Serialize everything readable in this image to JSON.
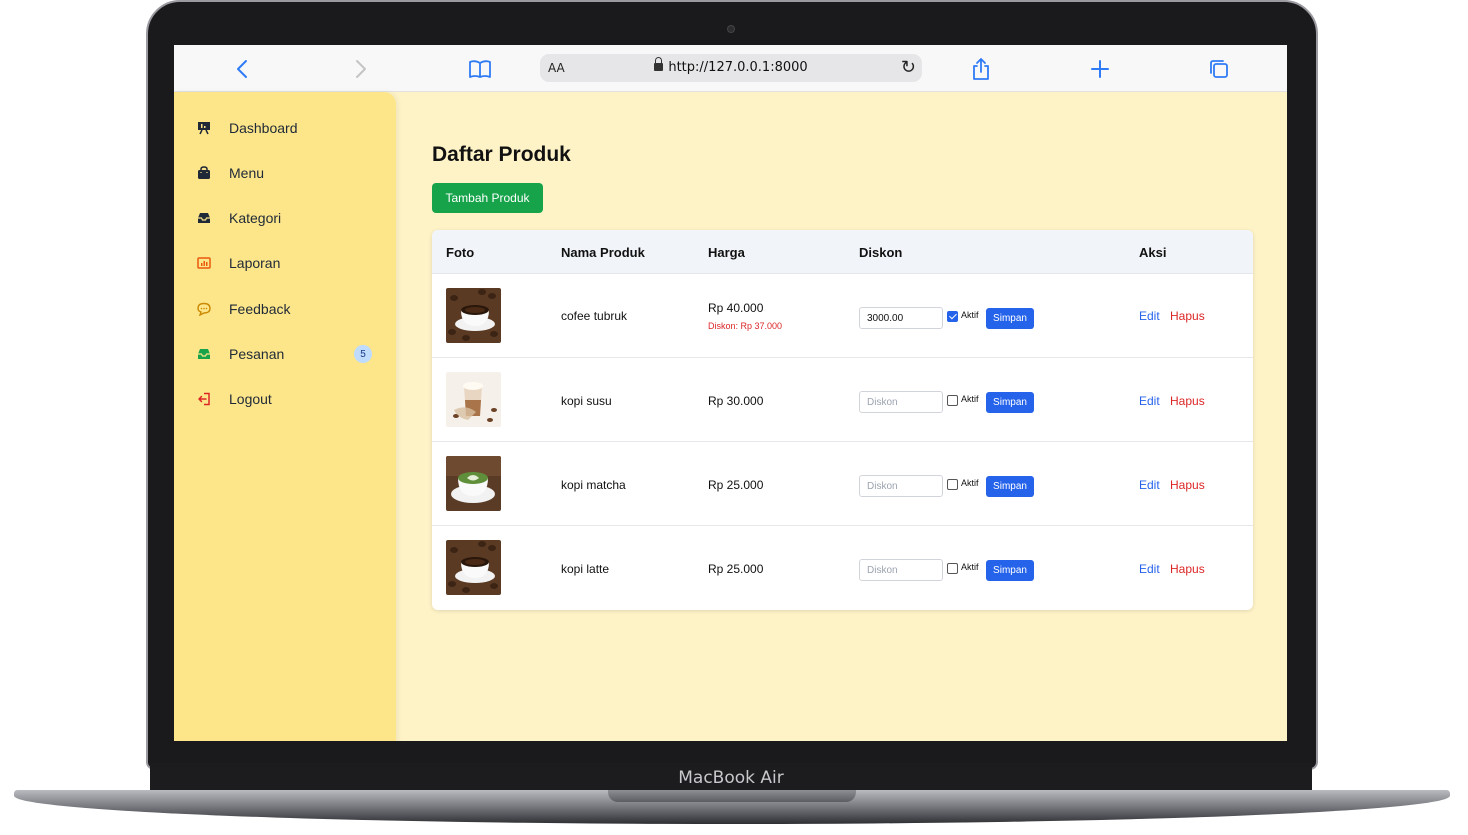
{
  "device": {
    "brand": "MacBook Air"
  },
  "browser": {
    "aa_label": "AA",
    "url": "http://127.0.0.1:8000",
    "icons": [
      "chevron-left-icon",
      "chevron-right-icon",
      "book-icon",
      "lock-icon",
      "reload-icon",
      "share-icon",
      "plus-icon",
      "tabs-icon"
    ]
  },
  "sidebar": {
    "items": [
      {
        "label": "Dashboard",
        "icon": "presentation-icon"
      },
      {
        "label": "Menu",
        "icon": "shopping-bag-icon"
      },
      {
        "label": "Kategori",
        "icon": "inbox-icon"
      },
      {
        "label": "Laporan",
        "icon": "chart-icon"
      },
      {
        "label": "Feedback",
        "icon": "chat-icon"
      },
      {
        "label": "Pesanan",
        "icon": "inbox-tray-icon",
        "badge": "5"
      },
      {
        "label": "Logout",
        "icon": "logout-icon"
      }
    ]
  },
  "main": {
    "title": "Daftar Produk",
    "add_button": "Tambah Produk",
    "columns": [
      "Foto",
      "Nama Produk",
      "Harga",
      "Diskon",
      "Aksi"
    ],
    "discount_placeholder": "Diskon",
    "active_label": "Aktif",
    "save_label": "Simpan",
    "edit_label": "Edit",
    "delete_label": "Hapus",
    "products": [
      {
        "name": "cofee tubruk",
        "price": "Rp 40.000",
        "discount_note": "Diskon: Rp 37.000",
        "discount_value": "3000.00",
        "active": true,
        "photo": "coffee-beans"
      },
      {
        "name": "kopi susu",
        "price": "Rp 30.000",
        "discount_note": "",
        "discount_value": "",
        "active": false,
        "photo": "iced-coffee"
      },
      {
        "name": "kopi matcha",
        "price": "Rp 25.000",
        "discount_note": "",
        "discount_value": "",
        "active": false,
        "photo": "matcha-latte"
      },
      {
        "name": "kopi latte",
        "price": "Rp 25.000",
        "discount_note": "",
        "discount_value": "",
        "active": false,
        "photo": "coffee-beans"
      }
    ]
  },
  "colors": {
    "sidebar_bg": "#fde68a",
    "page_bg": "#fef3c7",
    "add_button": "#16a34a",
    "save_button": "#2563eb",
    "edit_link": "#2563eb",
    "delete_link": "#dc2626"
  }
}
